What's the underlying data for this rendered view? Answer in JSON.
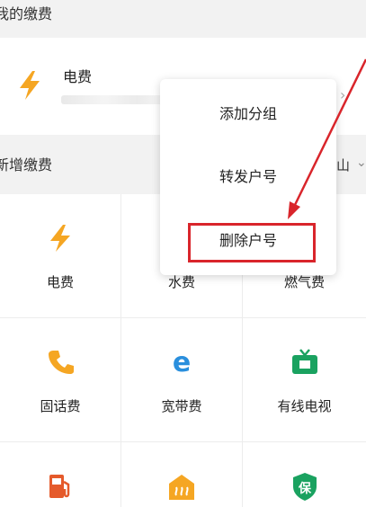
{
  "my_bills": {
    "header": "我的缴费",
    "card": {
      "title": "电费",
      "icon": "lightning-icon"
    }
  },
  "new_bill": {
    "header": "新增缴费",
    "location": "山"
  },
  "grid": [
    {
      "label": "电费",
      "icon": "lightning-icon"
    },
    {
      "label": "水费",
      "icon": "water-drop-icon"
    },
    {
      "label": "燃气费",
      "icon": "flame-icon"
    },
    {
      "label": "固话费",
      "icon": "phone-icon"
    },
    {
      "label": "宽带费",
      "icon": "broadband-e-icon"
    },
    {
      "label": "有线电视",
      "icon": "tv-icon"
    },
    {
      "label": "",
      "icon": "gas-station-icon"
    },
    {
      "label": "",
      "icon": "heating-icon"
    },
    {
      "label": "",
      "icon": "insurance-shield-icon",
      "glyph": "保"
    }
  ],
  "menu": {
    "items": [
      "添加分组",
      "转发户号",
      "删除户号"
    ]
  },
  "colors": {
    "accent_orange": "#f5a623",
    "broadband_blue": "#2a8fdd",
    "tv_green": "#1aa260",
    "annotation_red": "#d9252b"
  }
}
